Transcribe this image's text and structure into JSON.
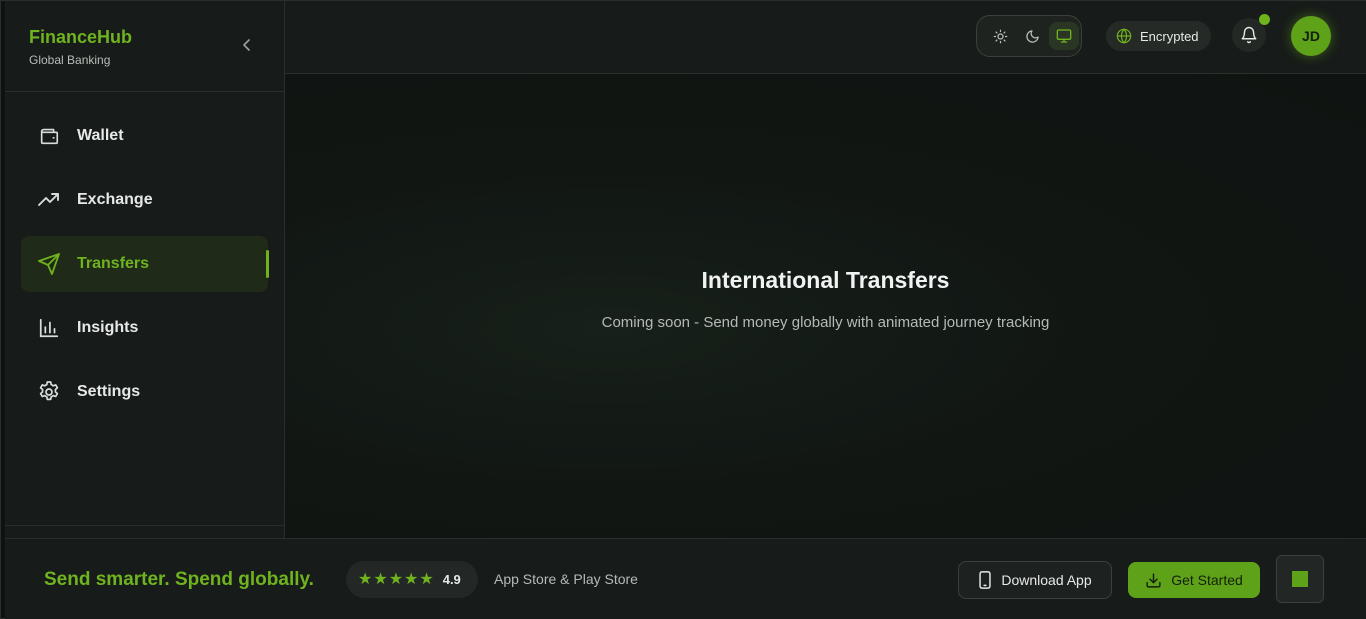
{
  "brand": {
    "name": "FinanceHub",
    "subtitle": "Global Banking"
  },
  "sidebar": {
    "items": [
      {
        "label": "Wallet",
        "icon": "wallet-icon",
        "active": false
      },
      {
        "label": "Exchange",
        "icon": "trending-up-icon",
        "active": false
      },
      {
        "label": "Transfers",
        "icon": "send-icon",
        "active": true
      },
      {
        "label": "Insights",
        "icon": "bar-chart-icon",
        "active": false
      },
      {
        "label": "Settings",
        "icon": "gear-icon",
        "active": false
      }
    ]
  },
  "header": {
    "theme_modes": [
      "light",
      "dark",
      "system"
    ],
    "theme_selected": "system",
    "encrypted_label": "Encrypted",
    "notifications_unread": true,
    "avatar_initials": "JD"
  },
  "main": {
    "title": "International Transfers",
    "subtitle": "Coming soon - Send money globally with animated journey tracking"
  },
  "footer": {
    "slogan": "Send smarter. Spend globally.",
    "rating": "4.9",
    "stars": 5,
    "stores": "App Store & Play Store",
    "download_label": "Download App",
    "get_started_label": "Get Started"
  },
  "colors": {
    "accent": "#6fb31e",
    "background": "#0e1210",
    "panel": "#171b19"
  }
}
